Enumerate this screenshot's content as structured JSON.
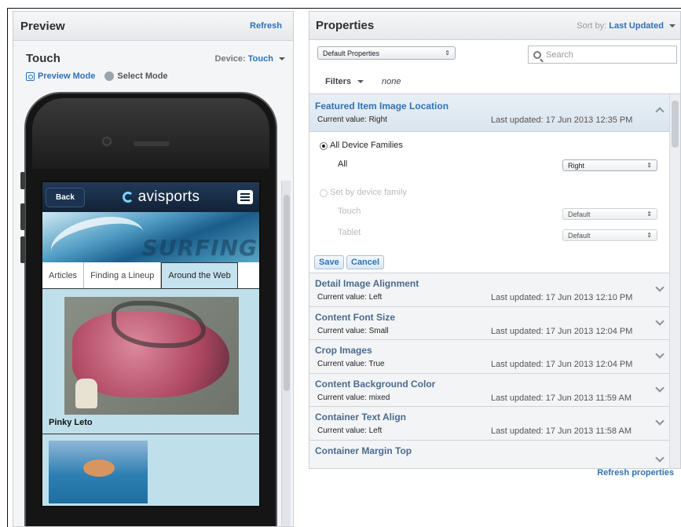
{
  "preview": {
    "title": "Preview",
    "refresh_label": "Refresh",
    "device_title": "Touch",
    "device_label": "Device:",
    "device_value": "Touch",
    "modes": {
      "preview": "Preview Mode",
      "select": "Select Mode"
    },
    "app": {
      "back_label": "Back",
      "logo_text": "avisports",
      "hero_word": "SURFING",
      "tabs": [
        "Articles",
        "Finding a Lineup",
        "Around the Web"
      ],
      "active_tab": "Around the Web",
      "article_caption": "Pinky Leto"
    }
  },
  "properties": {
    "title": "Properties",
    "sort_label": "Sort by:",
    "sort_value": "Last Updated",
    "property_set": "Default Properties",
    "search_placeholder": "Search",
    "filters_label": "Filters",
    "filters_value": "none",
    "expanded": {
      "name": "Featured Item Image Location",
      "current": "Current value: Right",
      "updated": "Last updated: 17 Jun 2013 12:35 PM",
      "all_families_label": "All Device Families",
      "all_label": "All",
      "all_value": "Right",
      "by_family_label": "Set by device family",
      "touch_label": "Touch",
      "touch_value": "Default",
      "tablet_label": "Tablet",
      "tablet_value": "Default",
      "save_label": "Save",
      "cancel_label": "Cancel"
    },
    "items": [
      {
        "name": "Detail Image Alignment",
        "current": "Current value: Left",
        "updated": "Last updated: 17 Jun 2013 12:10 PM"
      },
      {
        "name": "Content Font Size",
        "current": "Current value: Small",
        "updated": "Last updated: 17 Jun 2013 12:04 PM"
      },
      {
        "name": "Crop Images",
        "current": "Current value: True",
        "updated": "Last updated: 17 Jun 2013 12:04 PM"
      },
      {
        "name": "Content Background Color",
        "current": "Current value: mixed",
        "updated": "Last updated: 17 Jun 2013 11:59 AM"
      },
      {
        "name": "Container Text Align",
        "current": "Current value: Left",
        "updated": "Last updated: 17 Jun 2013 11:58 AM"
      },
      {
        "name": "Container Margin Top",
        "current": "",
        "updated": ""
      }
    ],
    "refresh_properties_label": "Refresh properties"
  },
  "colors": {
    "accent": "#2e72b8",
    "prop_name": "#4a6c8f",
    "app_bar": "#122236"
  }
}
